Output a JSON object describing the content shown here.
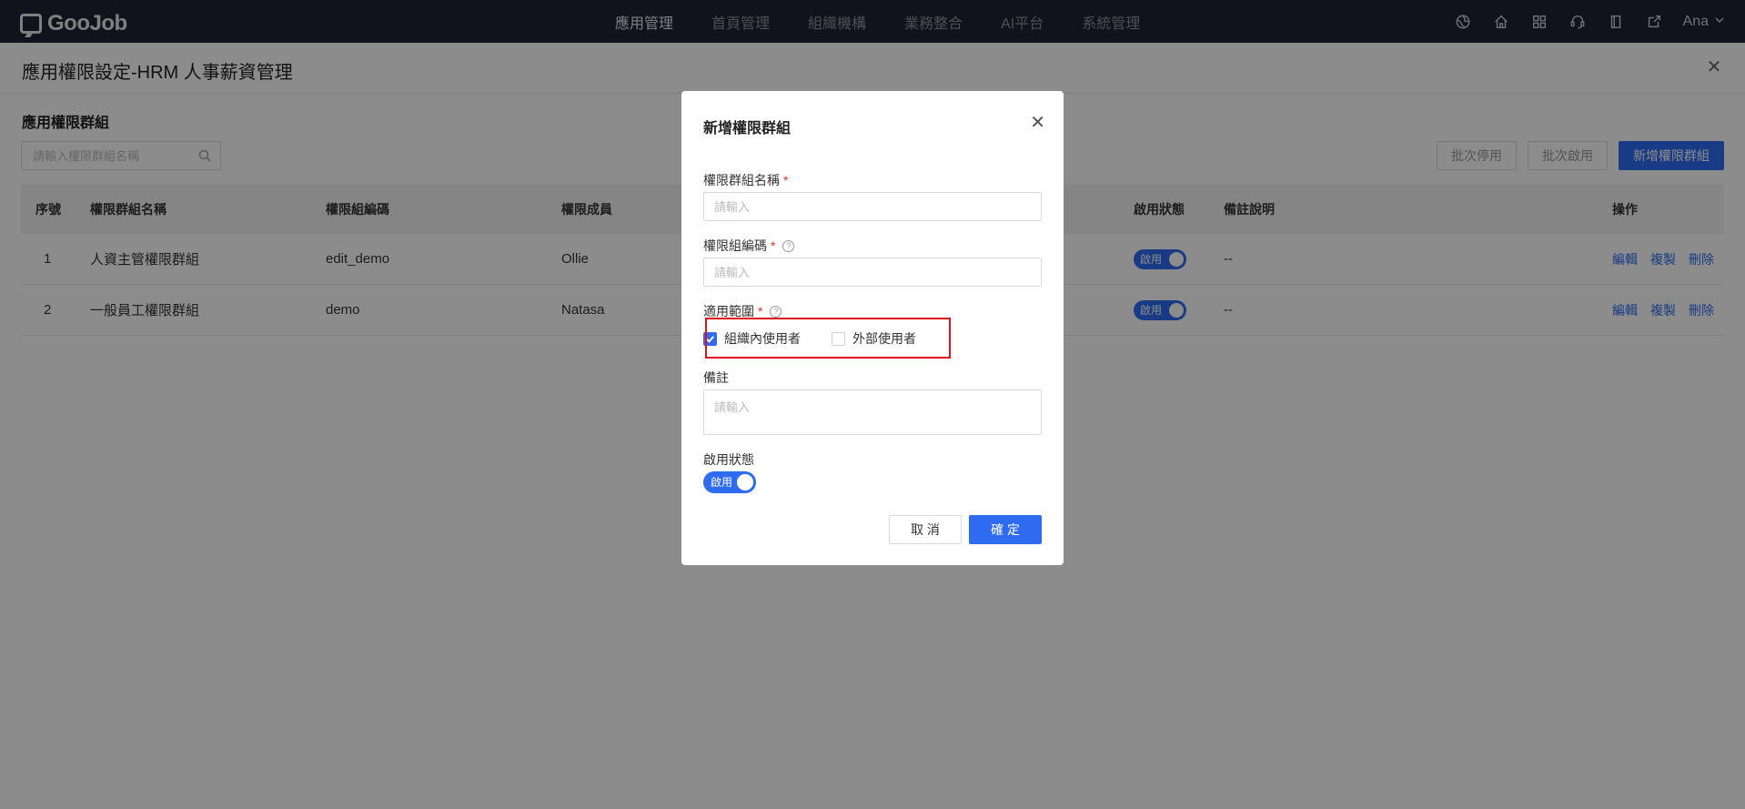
{
  "brand": {
    "name": "GooJob"
  },
  "nav": {
    "items": [
      "應用管理",
      "首頁管理",
      "組織機構",
      "業務整合",
      "AI平台",
      "系統管理"
    ],
    "active": "應用管理",
    "icons": [
      "globe-icon",
      "home-icon",
      "apps-grid-icon",
      "support-headset-icon",
      "book-icon",
      "export-icon"
    ],
    "user": "Ana"
  },
  "page": {
    "title": "應用權限設定-HRM 人事薪資管理",
    "section_title": "應用權限群組",
    "search_placeholder": "請輸入權限群組名稱",
    "buttons": {
      "batch_disable": "批次停用",
      "batch_enable": "批次啟用",
      "add_group": "新增權限群組"
    }
  },
  "table": {
    "headers": {
      "no": "序號",
      "name": "權限群組名稱",
      "code": "權限組編碼",
      "members": "權限成員",
      "status": "啟用狀態",
      "remark": "備註說明",
      "actions": "操作"
    },
    "rows": [
      {
        "no": "1",
        "name": "人資主管權限群組",
        "code": "edit_demo",
        "members": "Ollie",
        "status": "啟用",
        "remark": "--"
      },
      {
        "no": "2",
        "name": "一般員工權限群組",
        "code": "demo",
        "members": "Natasa",
        "status": "啟用",
        "remark": "--"
      }
    ],
    "ops": {
      "edit": "編輯",
      "copy": "複製",
      "delete": "刪除"
    }
  },
  "modal": {
    "title": "新增權限群組",
    "fields": {
      "group_name": {
        "label": "權限群組名稱",
        "placeholder": "請輸入"
      },
      "group_code": {
        "label": "權限組編碼",
        "placeholder": "請輸入"
      },
      "scope": {
        "label": "適用範圍",
        "options": [
          {
            "label": "組織內使用者",
            "checked": true
          },
          {
            "label": "外部使用者",
            "checked": false
          }
        ]
      },
      "remark": {
        "label": "備註",
        "placeholder": "請輸入"
      },
      "status": {
        "label": "啟用狀態",
        "value": "啟用",
        "on": true
      }
    },
    "required_mark": "*",
    "cancel": "取 消",
    "confirm": "確 定"
  },
  "colors": {
    "primary": "#2f6bf0",
    "nav_bg": "#1f2433",
    "highlight": "#e0121c",
    "required": "#e2342f"
  }
}
